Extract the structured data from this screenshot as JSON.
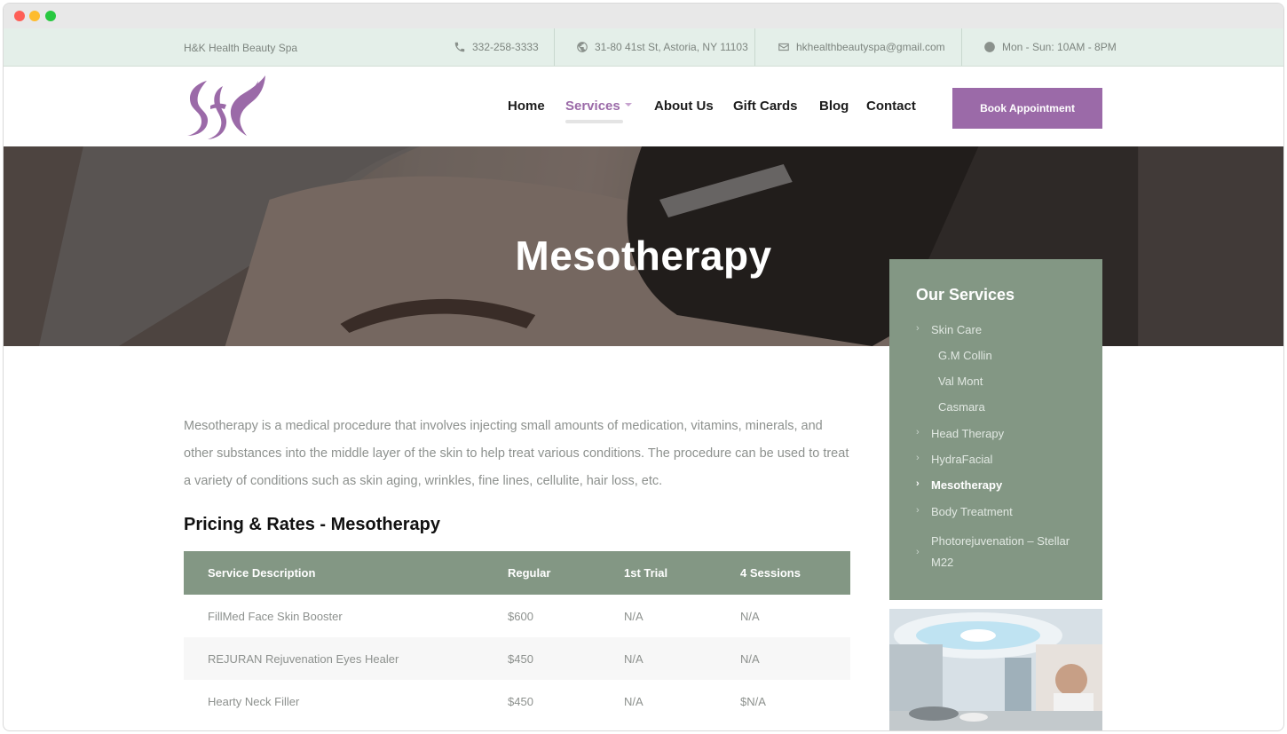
{
  "topbar": {
    "brand": "H&K Health Beauty Spa",
    "phone": "332-258-3333",
    "address": "31-80 41st St, Astoria, NY 11103",
    "email": "hkhealthbeautyspa@gmail.com",
    "hours": "Mon - Sun: 10AM - 8PM",
    "icons": [
      "phone-icon",
      "globe-icon",
      "envelope-icon",
      "clock-icon"
    ]
  },
  "nav": {
    "items": [
      {
        "label": "Home"
      },
      {
        "label": "Services"
      },
      {
        "label": "About Us"
      },
      {
        "label": "Gift Cards"
      },
      {
        "label": "Blog"
      },
      {
        "label": "Contact"
      }
    ],
    "book_label": "Book Appointment"
  },
  "hero": {
    "title": "Mesotherapy"
  },
  "intro": "Mesotherapy is a medical procedure that involves injecting small amounts of medication, vitamins, minerals, and other substances into the middle layer of the skin to help treat various conditions. The procedure can be used to treat a variety of conditions such as skin aging, wrinkles, fine lines, cellulite, hair loss, etc.",
  "pricing": {
    "title": "Pricing & Rates - Mesotherapy",
    "headers": [
      "Service Description",
      "Regular",
      "1st Trial",
      "4 Sessions"
    ],
    "rows": [
      [
        "FillMed Face Skin Booster",
        "$600",
        "N/A",
        "N/A"
      ],
      [
        "REJURAN Rejuvenation Eyes Healer",
        "$450",
        "N/A",
        "N/A"
      ],
      [
        "Hearty Neck Filler",
        "$450",
        "N/A",
        "$N/A"
      ]
    ]
  },
  "sidebar": {
    "title": "Our Services",
    "items": [
      {
        "label": "Skin Care"
      },
      {
        "label": "G.M Collin"
      },
      {
        "label": "Val Mont"
      },
      {
        "label": "Casmara"
      },
      {
        "label": "Head Therapy"
      },
      {
        "label": "HydraFacial"
      },
      {
        "label": "Mesotherapy"
      },
      {
        "label": "Body Treatment"
      },
      {
        "label": "Photorejuvenation – Stellar M22"
      }
    ]
  },
  "colors": {
    "accent": "#9b6aa8",
    "sage": "#839784",
    "topbar_bg": "#e4efe9"
  }
}
